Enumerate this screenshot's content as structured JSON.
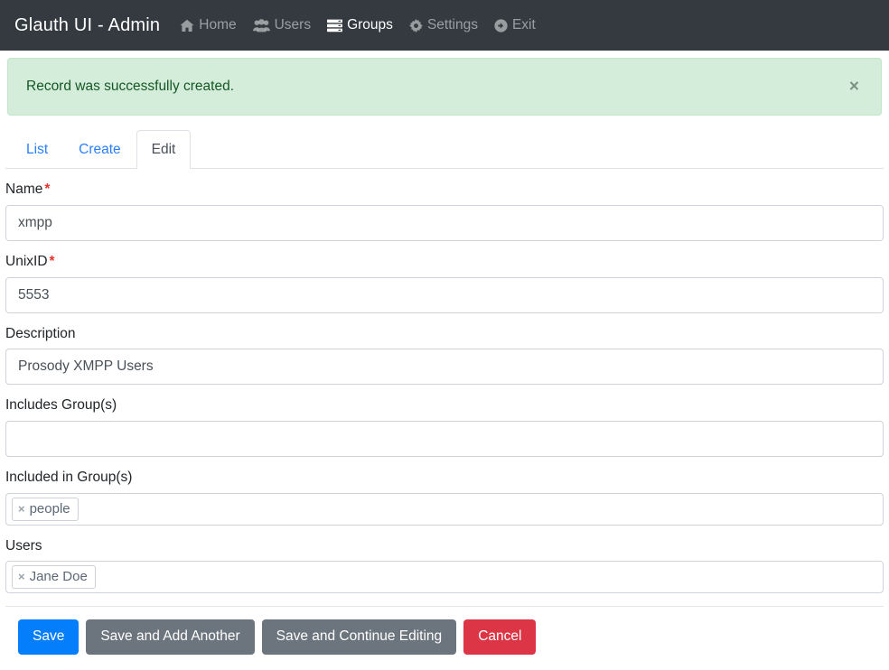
{
  "navbar": {
    "brand": "Glauth UI - Admin",
    "items": [
      {
        "label": "Home",
        "icon": "home-icon",
        "active": false
      },
      {
        "label": "Users",
        "icon": "users-icon",
        "active": false
      },
      {
        "label": "Groups",
        "icon": "server-stack-icon",
        "active": true
      },
      {
        "label": "Settings",
        "icon": "gear-icon",
        "active": false
      },
      {
        "label": "Exit",
        "icon": "arrow-circle-right-icon",
        "active": false
      }
    ],
    "background": "#343a40"
  },
  "alert": {
    "message": "Record was successfully created.",
    "close_label": "×",
    "background": "#d4edda",
    "text_color": "#155724"
  },
  "tabs": [
    {
      "label": "List",
      "active": false
    },
    {
      "label": "Create",
      "active": false
    },
    {
      "label": "Edit",
      "active": true
    }
  ],
  "form": {
    "name": {
      "label": "Name",
      "required": true,
      "required_mark": "*",
      "value": "xmpp",
      "placeholder": ""
    },
    "unixid": {
      "label": "UnixID",
      "required": true,
      "required_mark": "*",
      "value": "5553",
      "placeholder": ""
    },
    "description": {
      "label": "Description",
      "required": false,
      "value": "Prosody XMPP Users",
      "placeholder": ""
    },
    "includes_groups": {
      "label": "Includes Group(s)",
      "required": false,
      "value": "",
      "placeholder": "",
      "tags": []
    },
    "included_in_groups": {
      "label": "Included in Group(s)",
      "required": false,
      "tags": [
        {
          "label": "people",
          "remove": "×"
        }
      ]
    },
    "users": {
      "label": "Users",
      "required": false,
      "tags": [
        {
          "label": "Jane Doe",
          "remove": "×"
        }
      ]
    }
  },
  "buttons": [
    {
      "label": "Save",
      "style": "primary",
      "color": "#057efc"
    },
    {
      "label": "Save and Add Another",
      "style": "secondary",
      "color": "#6c757d"
    },
    {
      "label": "Save and Continue Editing",
      "style": "secondary",
      "color": "#6c757d"
    },
    {
      "label": "Cancel",
      "style": "danger",
      "color": "#dc3545"
    }
  ]
}
